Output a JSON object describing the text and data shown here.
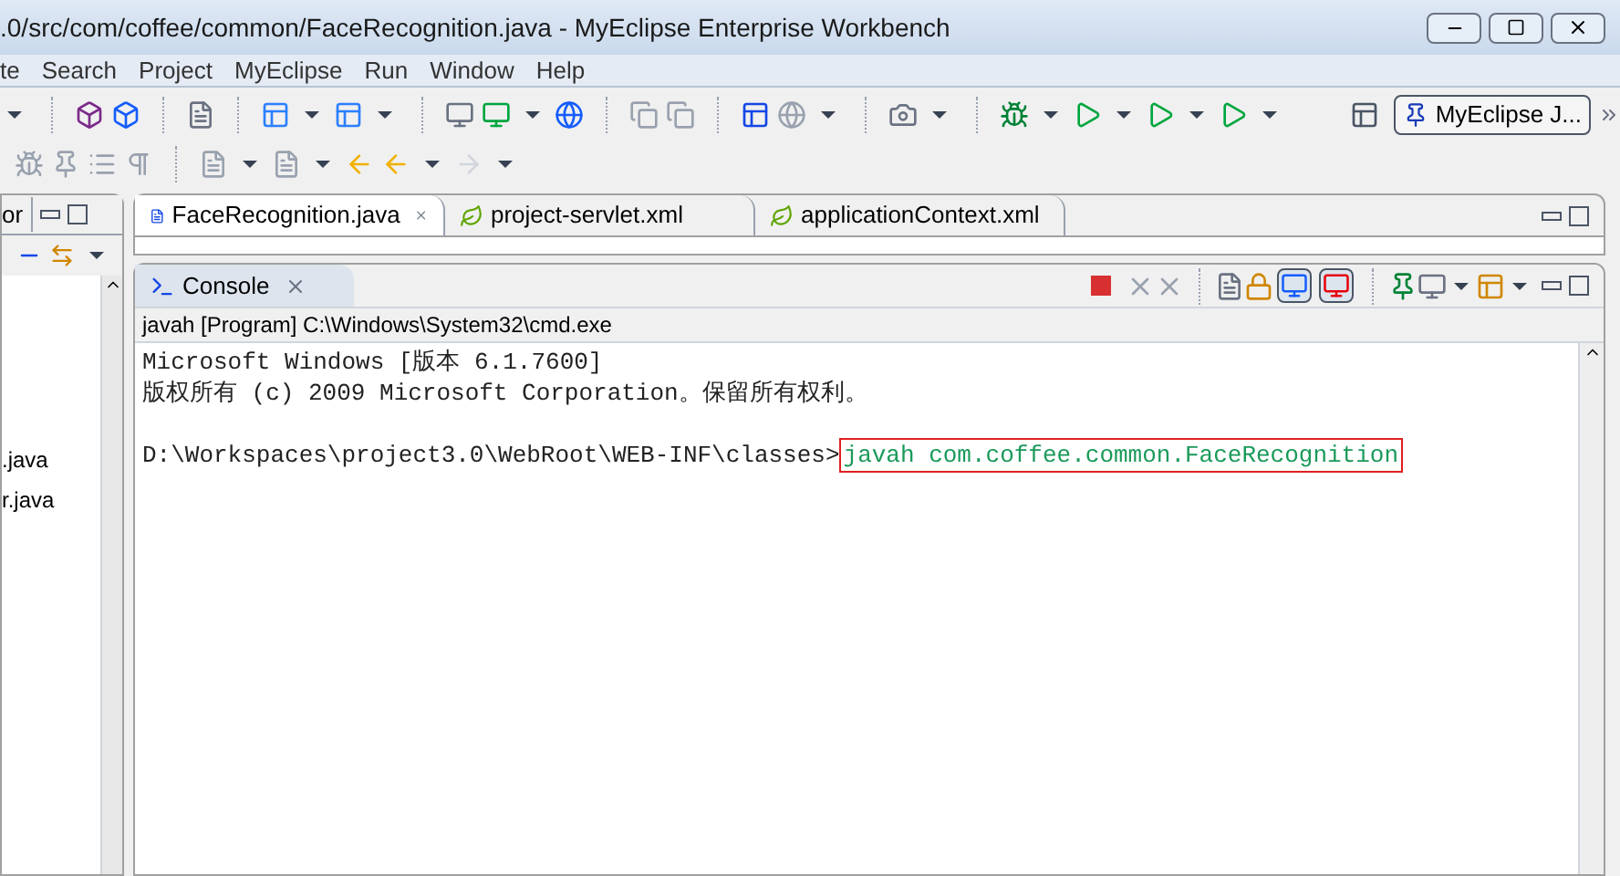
{
  "window": {
    "title": ".0/src/com/coffee/common/FaceRecognition.java - MyEclipse Enterprise Workbench"
  },
  "menu": [
    "te",
    "Search",
    "Project",
    "MyEclipse",
    "Run",
    "Window",
    "Help"
  ],
  "perspective": {
    "label": "MyEclipse J...",
    "selected": true
  },
  "left_pane": {
    "tab": "or",
    "items": [
      ".java",
      "r.java"
    ]
  },
  "editor_tabs": [
    {
      "label": "FaceRecognition.java",
      "kind": "java",
      "selected": true,
      "closable": true
    },
    {
      "label": "project-servlet.xml",
      "kind": "xml",
      "selected": false,
      "closable": false
    },
    {
      "label": "applicationContext.xml",
      "kind": "xml",
      "selected": false,
      "closable": false
    }
  ],
  "console": {
    "tab": "Console",
    "process": "javah [Program] C:\\Windows\\System32\\cmd.exe",
    "lines": [
      "Microsoft Windows [版本 6.1.7600]",
      "版权所有 (c) 2009 Microsoft Corporation。保留所有权利。"
    ],
    "prompt": "D:\\Workspaces\\project3.0\\WebRoot\\WEB-INF\\classes>",
    "command": "javah com.coffee.common.FaceRecognition",
    "command_highlighted": true
  }
}
